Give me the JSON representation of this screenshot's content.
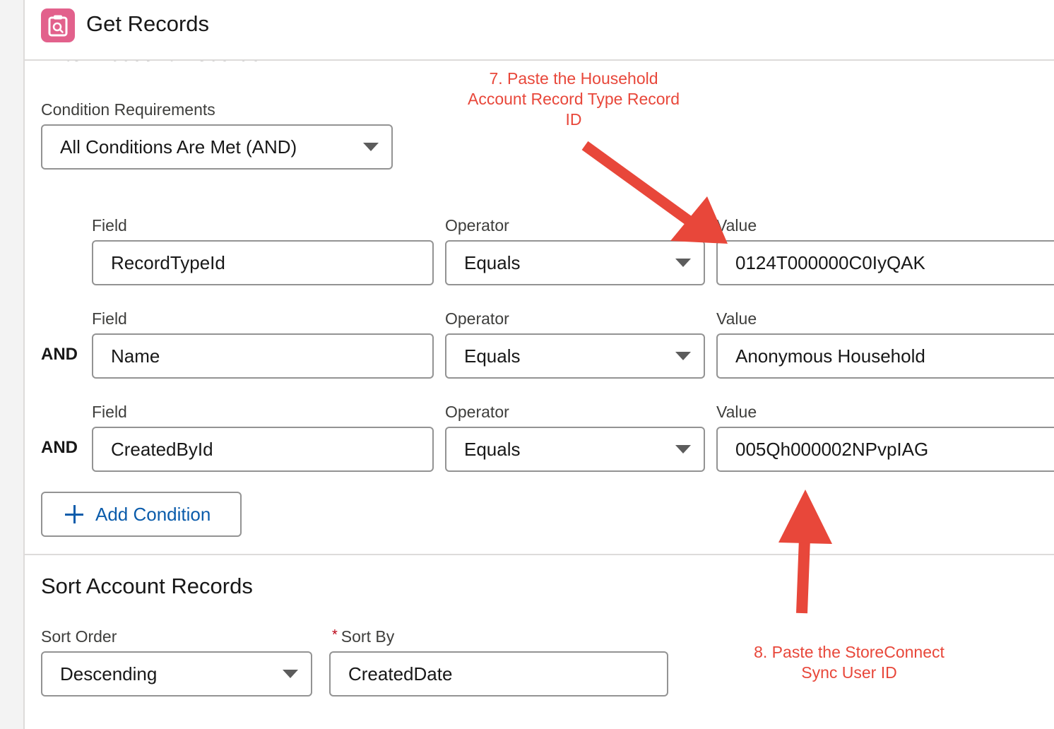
{
  "header": {
    "title": "Get Records",
    "icon": "get-records-icon",
    "icon_color": "#e2618c"
  },
  "filter": {
    "section_title_partial": "Filter Account Records",
    "condition_requirements_label": "Condition Requirements",
    "condition_requirements_value": "All Conditions Are Met (AND)",
    "conditions": [
      {
        "connector": "",
        "field_label": "Field",
        "field": "RecordTypeId",
        "operator_label": "Operator",
        "operator": "Equals",
        "value_label": "Value",
        "value": "0124T000000C0IyQAK"
      },
      {
        "connector": "AND",
        "field_label": "Field",
        "field": "Name",
        "operator_label": "Operator",
        "operator": "Equals",
        "value_label": "Value",
        "value": "Anonymous Household"
      },
      {
        "connector": "AND",
        "field_label": "Field",
        "field": "CreatedById",
        "operator_label": "Operator",
        "operator": "Equals",
        "value_label": "Value",
        "value": "005Qh000002NPvpIAG"
      }
    ],
    "add_condition_label": "Add Condition"
  },
  "sort": {
    "section_title": "Sort Account Records",
    "sort_order_label": "Sort Order",
    "sort_order_value": "Descending",
    "sort_by_required_marker": "*",
    "sort_by_label": "Sort By",
    "sort_by_value": "CreatedDate"
  },
  "annotations": {
    "step7": [
      "7. Paste the Household",
      "Account Record Type Record",
      "ID"
    ],
    "step8": [
      "8. Paste the StoreConnect",
      "Sync User ID"
    ],
    "color": "#e8473a"
  },
  "colors": {
    "link_blue": "#0b5cab",
    "border": "#939393",
    "divider": "#dddbda"
  }
}
